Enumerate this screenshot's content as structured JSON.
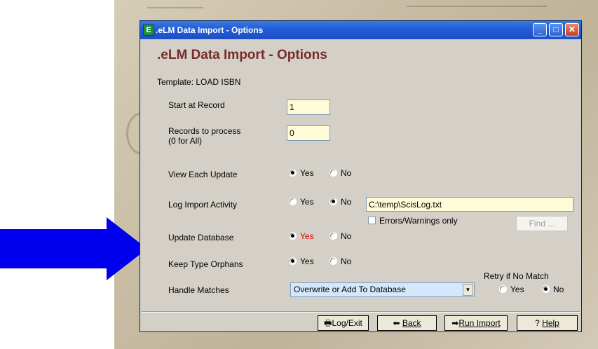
{
  "window": {
    "title": ".eLM Data Import  - Options",
    "heading": ".eLM Data Import  - Options",
    "icon": "app-icon",
    "controls": {
      "minimize": "_",
      "maximize": "□",
      "close": "✕"
    }
  },
  "template_label": "Template: LOAD ISBN",
  "start_at_record": {
    "label": "Start at Record",
    "value": "1"
  },
  "records_to_process": {
    "label_line1": "Records to process",
    "label_line2": "(0 for All)",
    "value": "0"
  },
  "view_each_update": {
    "label": "View Each Update",
    "yes": "Yes",
    "no": "No",
    "selected": "yes"
  },
  "log_import_activity": {
    "label": "Log Import Activity",
    "yes": "Yes",
    "no": "No",
    "selected": "no",
    "path": "C:\\temp\\ScisLog.txt",
    "errors_only": "Errors/Warnings only",
    "find": "Find ..."
  },
  "update_database": {
    "label": "Update Database",
    "yes": "Yes",
    "no": "No",
    "selected": "yes"
  },
  "keep_type_orphans": {
    "label": "Keep Type Orphans",
    "yes": "Yes",
    "no": "No",
    "selected": "yes"
  },
  "handle_matches": {
    "label": "Handle Matches",
    "value": "Overwrite or Add To Database"
  },
  "retry_if_no_match": {
    "label": "Retry if No Match",
    "yes": "Yes",
    "no": "No",
    "selected": "no"
  },
  "buttons": {
    "log_exit": "Log/Exit",
    "back": "Back",
    "run_import": "Run Import",
    "help": "Help"
  },
  "colors": {
    "heading": "#7a2a2a",
    "titlebar": "#245edb",
    "arrow": "#0000ee",
    "window": "#d4d0c8"
  }
}
